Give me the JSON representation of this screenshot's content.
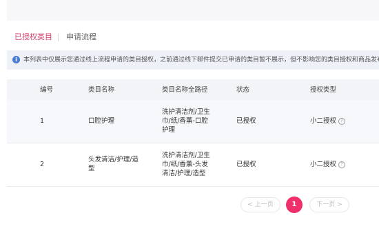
{
  "tabs": [
    {
      "label": "已授权类目",
      "active": true
    },
    {
      "label": "申请流程",
      "active": false
    }
  ],
  "notice": {
    "icon": "info-icon",
    "text": "本列表中仅展示您通过线上流程申请的类目授权，之前通过线下邮件提交已申请的类目暂不展示，但不影响您的类目授权和商品发布，请"
  },
  "table": {
    "headers": [
      "编号",
      "类目名称",
      "类目名称全路径",
      "状态",
      "授权类型"
    ],
    "rows": [
      {
        "id": "1",
        "name": "口腔护理",
        "path": [
          "洗护清洁剂/卫生",
          "巾/纸/香薰-口腔",
          "护理"
        ],
        "status": "已授权",
        "type": "小二授权"
      },
      {
        "id": "2",
        "name": [
          "头发清洁/护理/造",
          "型"
        ],
        "path": [
          "洗护清洁剂/卫生",
          "巾/纸/香薰-头发",
          "清洁/护理/造型"
        ],
        "status": "已授权",
        "type": "小二授权"
      }
    ]
  },
  "pagination": {
    "prev": "< 上一页",
    "current": "1",
    "next": "下一页 >"
  },
  "colors": {
    "accent": "#f0306a",
    "tab_active": "#d43f6b",
    "notice_bg": "#eef1f8"
  }
}
